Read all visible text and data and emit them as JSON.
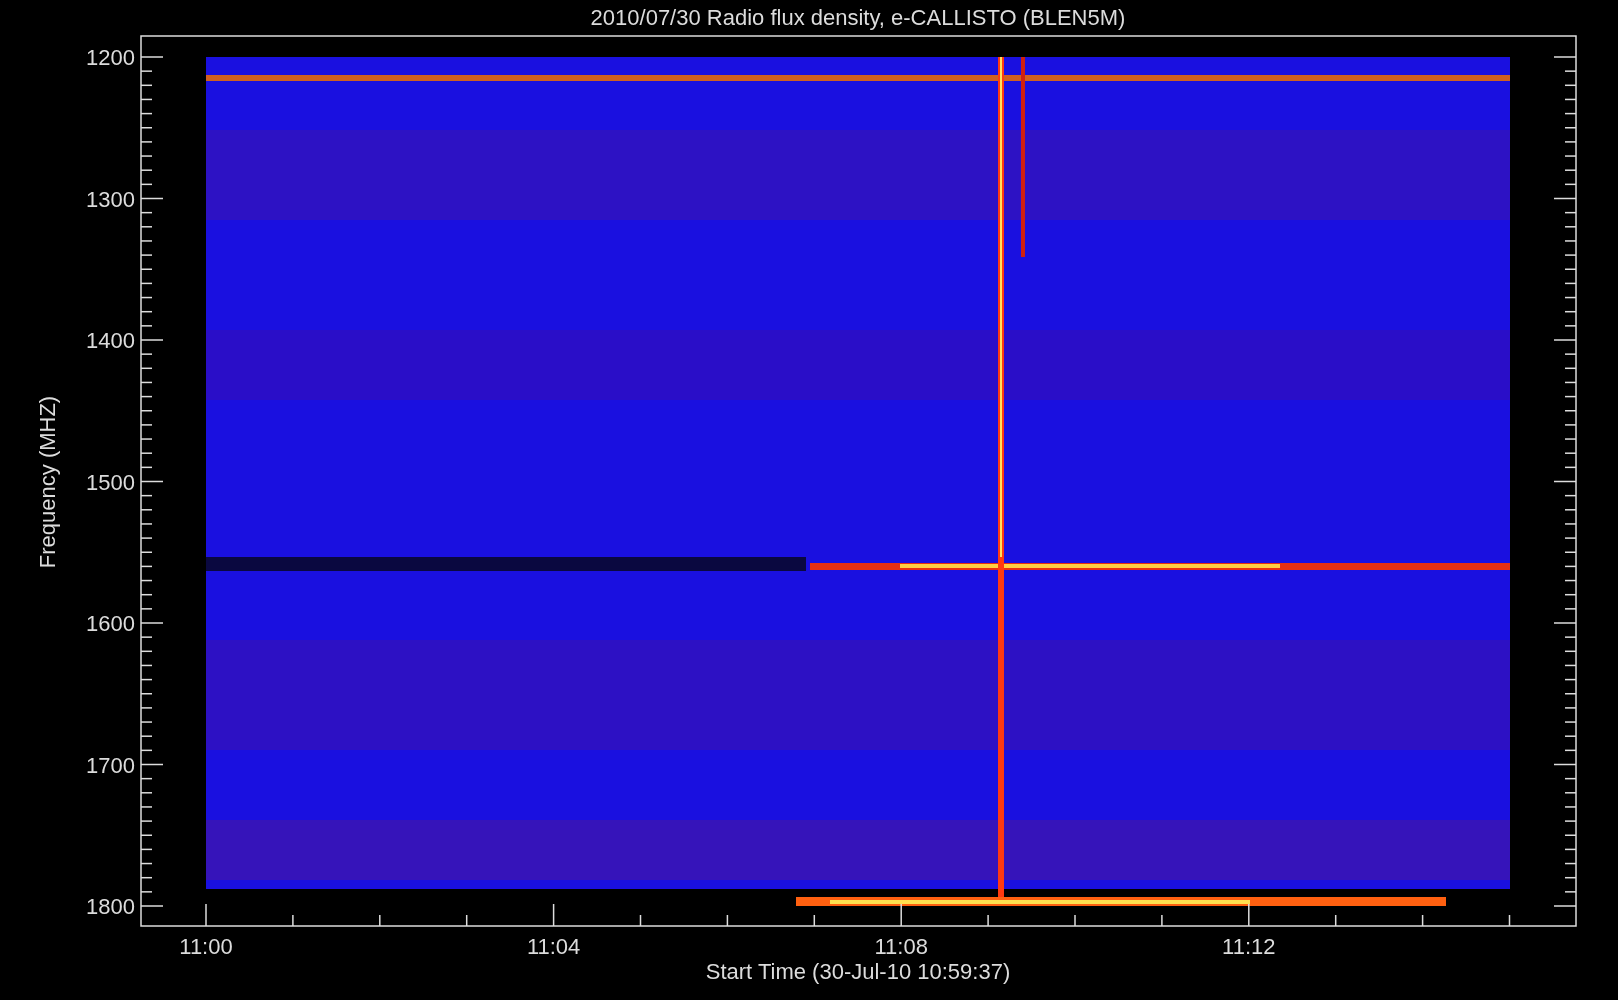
{
  "chart": {
    "title": "2010/07/30  Radio flux density, e-CALLISTO (BLEN5M)",
    "xlabel": "Start Time (30-Jul-10 10:59:37)",
    "ylabel": "Frequency (MHZ)",
    "yticks": [
      {
        "label": "1200"
      },
      {
        "label": "1300"
      },
      {
        "label": "1400"
      },
      {
        "label": "1500"
      },
      {
        "label": "1600"
      },
      {
        "label": "1700"
      },
      {
        "label": "1800"
      }
    ],
    "xticks": [
      {
        "label": "11:00"
      },
      {
        "label": "11:04"
      },
      {
        "label": "11:08"
      },
      {
        "label": "11:12"
      }
    ]
  }
}
